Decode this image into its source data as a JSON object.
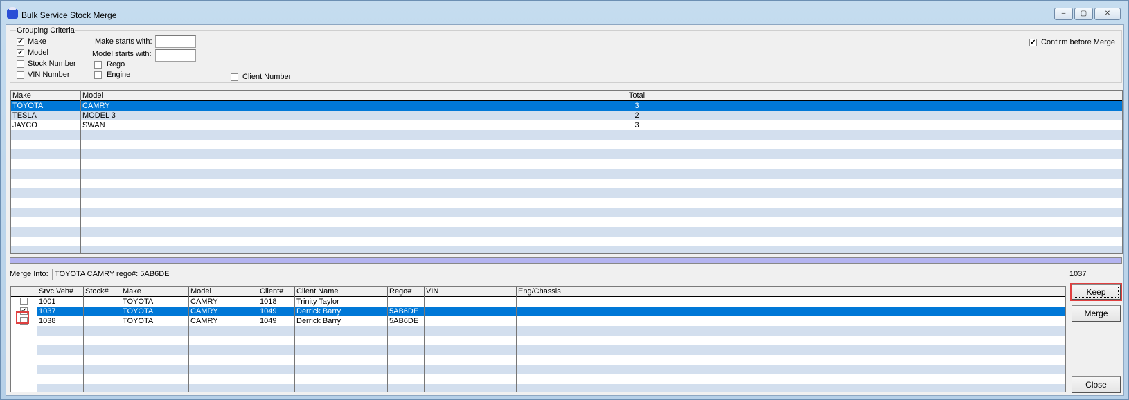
{
  "window": {
    "title": "Bulk Service Stock Merge",
    "controls": {
      "minimize": "‒",
      "maximize": "▢",
      "close": "✕"
    }
  },
  "grouping": {
    "label": "Grouping Criteria",
    "make": {
      "label": "Make",
      "checked": true
    },
    "model": {
      "label": "Model",
      "checked": true
    },
    "stock_number": {
      "label": "Stock Number",
      "checked": false
    },
    "vin_number": {
      "label": "VIN Number",
      "checked": false
    },
    "make_starts_label": "Make starts with:",
    "make_starts_value": "",
    "model_starts_label": "Model starts with:",
    "model_starts_value": "",
    "rego": {
      "label": "Rego",
      "checked": false
    },
    "engine": {
      "label": "Engine",
      "checked": false
    },
    "client_number": {
      "label": "Client Number",
      "checked": false
    },
    "confirm": {
      "label": "Confirm before Merge",
      "checked": true
    }
  },
  "groups_grid": {
    "columns": [
      "Make",
      "Model",
      "Total"
    ],
    "rows": [
      {
        "make": "TOYOTA",
        "model": "CAMRY",
        "total": "3",
        "selected": true
      },
      {
        "make": "TESLA",
        "model": "MODEL 3",
        "total": "2"
      },
      {
        "make": "JAYCO",
        "model": "SWAN",
        "total": "3"
      }
    ]
  },
  "merge_into": {
    "label": "Merge Into:",
    "value": "TOYOTA CAMRY rego#: 5AB6DE",
    "id": "1037"
  },
  "vehicles_grid": {
    "columns": [
      "",
      "Srvc Veh#",
      "Stock#",
      "Make",
      "Model",
      "Client#",
      "Client Name",
      "Rego#",
      "VIN",
      "Eng/Chassis"
    ],
    "rows": [
      {
        "checked": false,
        "srvc": "1001",
        "stock": "",
        "make": "TOYOTA",
        "model": "CAMRY",
        "client": "1018",
        "name": "Trinity Taylor",
        "rego": "",
        "vin": "",
        "eng": ""
      },
      {
        "checked": true,
        "selected": true,
        "srvc": "1037",
        "stock": "",
        "make": "TOYOTA",
        "model": "CAMRY",
        "client": "1049",
        "name": "Derrick Barry",
        "rego": "5AB6DE",
        "vin": "",
        "eng": ""
      },
      {
        "checked": false,
        "srvc": "1038",
        "stock": "",
        "make": "TOYOTA",
        "model": "CAMRY",
        "client": "1049",
        "name": "Derrick Barry",
        "rego": "5AB6DE",
        "vin": "",
        "eng": ""
      }
    ]
  },
  "buttons": {
    "keep": "Keep",
    "merge": "Merge",
    "close": "Close"
  },
  "colors": {
    "selection": "#0078d7",
    "stripe": "#d3dfee",
    "splitter": "#b4b4f0",
    "highlight": "#e04040"
  }
}
